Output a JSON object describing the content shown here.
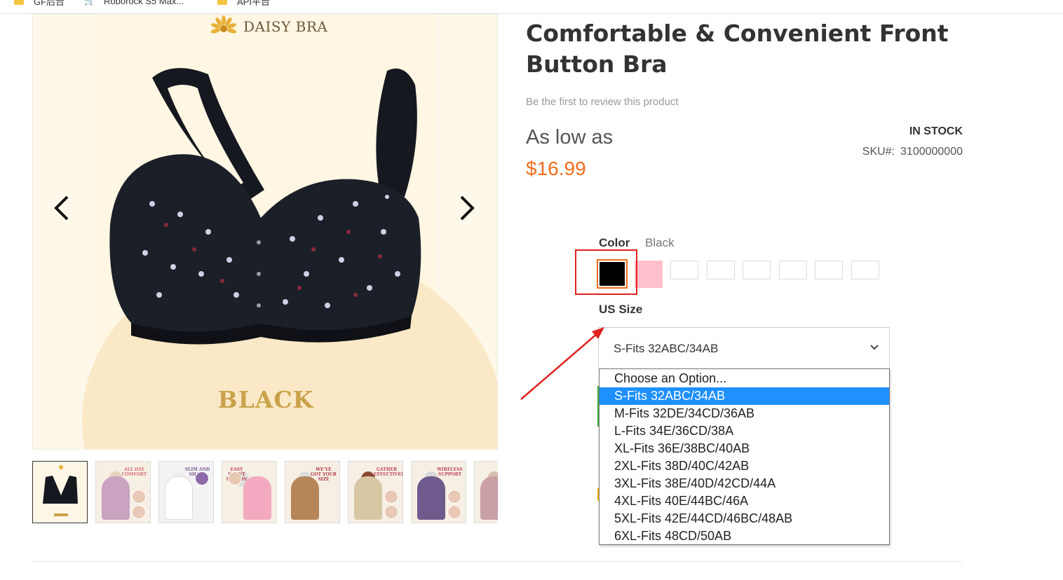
{
  "bookmarks": [
    {
      "label": "GF后台",
      "icon": "folder-icon"
    },
    {
      "label": "Roborock S5 Max...",
      "icon": "cart-icon"
    },
    {
      "label": "API平台",
      "icon": "folder-icon"
    }
  ],
  "gallery": {
    "brand": "DAISY BRA",
    "caption": "BLACK",
    "prev_icon": "chevron-left-icon",
    "next_icon": "chevron-right-icon",
    "thumbnails": [
      {
        "banner": ""
      },
      {
        "banner": "ALL DAY COMFORT"
      },
      {
        "banner": "SLIM AND SHAPE"
      },
      {
        "banner": "EASY FRONT BUTTON"
      },
      {
        "banner": "WE'VE GOT YOUR SIZE"
      },
      {
        "banner": "GATHER EFFECTIVELY"
      },
      {
        "banner": "WIRELESS SUPPORT"
      },
      {
        "banner": ""
      }
    ]
  },
  "product": {
    "title": "Comfortable & Convenient Front Button Bra",
    "review_link": "Be the first to review this product",
    "as_low_as": "As low as",
    "price": "$16.99",
    "stock": "IN STOCK",
    "sku_label": "SKU#:",
    "sku_value": "3100000000"
  },
  "options": {
    "color_label": "Color",
    "color_value": "Black",
    "swatches": [
      {
        "name": "Black",
        "color": "#000000"
      },
      {
        "name": "Pink",
        "color": "#ffc0cb"
      },
      {
        "name": "",
        "color": "#ffffff"
      },
      {
        "name": "",
        "color": "#ffffff"
      },
      {
        "name": "",
        "color": "#ffffff"
      },
      {
        "name": "",
        "color": "#ffffff"
      },
      {
        "name": "",
        "color": "#ffffff"
      },
      {
        "name": "",
        "color": "#ffffff"
      }
    ],
    "size_label": "US Size",
    "size_selected": "S-Fits 32ABC/34AB",
    "size_options": [
      "Choose an Option...",
      "S-Fits 32ABC/34AB",
      "M-Fits 32DE/34CD/36AB",
      "L-Fits 34E/36CD/38A",
      "XL-Fits 36E/38BC/40AB",
      "2XL-Fits 38D/40C/42AB",
      "3XL-Fits 38E/40D/42CD/44A",
      "4XL-Fits 40E/44BC/46A",
      "5XL-Fits 42E/44CD/46BC/48AB",
      "6XL-Fits 48CD/50AB"
    ],
    "selected_index": 1
  },
  "colors": {
    "accent_price": "#f26c1c",
    "annotation_red": "#e02020",
    "dropdown_highlight": "#1e90ff"
  }
}
